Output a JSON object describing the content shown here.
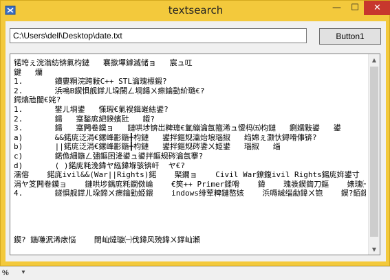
{
  "window": {
    "title": "textsearch",
    "minimize": "—",
    "maximize": "☐",
    "close": "✕"
  },
  "path_field": {
    "value": "C:\\Users\\dell\\Desktop\\date.txt"
  },
  "button1": {
    "label": "Button1"
  },
  "textarea": {
    "lines": [
      "锘垮ぇ浣滃紡锛氭枃鏈   褰撳墠鎼滅储ョ   宸ュ叿",
      "鍵   爤",
      "1.       鐨婁粡浣跨敤C++ STL瀹瑰櫒鍜?",
      "2.       浜嗚В鍥惧舰鐣ㄦ垜閿ㄥ埛鍚ㄨ瘝鑰勭紒璐€?",
      "鍔熻兘闇€姹?",
      "1.       鐢ㄦ埛鍙   憡瑕€氭祦鍓嶉紶鍙?",
      "2.       鍚   寔鍫庣紦鍨嬪瓧   鍜?",
      "3.       鍚   寔闁卷鏌ョ   鏈哄埗锛岀粺璁€氳繃瀹氬箍浠ュ懓杩㈤枃鏈   鍘嬬敤鍙   鍙",
      "a)       &&鍩庣泛涓€鏍峰彲鍦╂枃鏈   鍙拌鏂规瀹炲埌瑙掓   绉婂ぇ灏忕鐞嗗倳锛?",
      "b)       ||鍩庣泛涓€鏍峰彲鍦╂枃鏈   鍙拌鏂规硶鍌ㄨ姫鍙   瑙掓   缁",
      "c)       鍩佹細鍦ㄥ彇鏂囨湰鍙ュ鍙拌鏂规硶瀹氬搴?",
      "d)       ( )鍩庣粍浼鍏ヤ紭鍏堢骇锛屽  ヤ€?",
      "濡傛    鍩庣ivil&&(War||Rights)鍩    棸鐗ョ    Civil War鐐鍑ivil Rights鍚庣姩鍙寸    鑺傚皥鍚庢寜鐓ф簮",
      "涓ヤ笅闁卷鏌ョ    鏈哄埗鍝庣粍鐗傚崘    €笶++ Primer鍒嗗    鍏    瑰彂鍥鍧刀鏂    婊瑰㈠鍙",
      "4.       鐩惧舰鐣ㄦ垜鍗ㄨ瘝鑰勭姫鍡    indows绯荤粺鏈嶅姟    浜嗕絾缁勮鍏ㄨ铇    鍥?銆鍒獣鎬",
      "",
      "",
      "",
      "",
      "鍥? 鍦嗛泦浠庡悩    閉屾燵璇㈠伐鍏风殑鍏ㄨ鐣屾瀬"
    ]
  },
  "statusbar": {
    "zoom": "%",
    "dropdown": "▼"
  }
}
